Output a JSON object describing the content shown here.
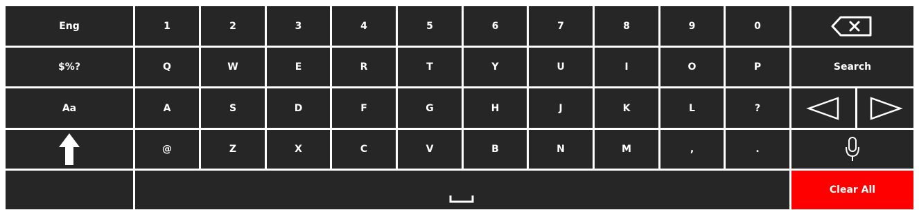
{
  "keyboard": {
    "row1": {
      "lang": "Eng",
      "digits": [
        "1",
        "2",
        "3",
        "4",
        "5",
        "6",
        "7",
        "8",
        "9",
        "0"
      ],
      "backspace_icon": "backspace-icon"
    },
    "row2": {
      "symbols": "$%?",
      "letters": [
        "Q",
        "W",
        "E",
        "R",
        "T",
        "Y",
        "U",
        "I",
        "O",
        "P"
      ],
      "search": "Search"
    },
    "row3": {
      "case": "Aa",
      "letters": [
        "A",
        "S",
        "D",
        "F",
        "G",
        "H",
        "J",
        "K",
        "L",
        "?"
      ],
      "left_icon": "arrow-left-icon",
      "right_icon": "arrow-right-icon"
    },
    "row4": {
      "shift_icon": "shift-arrow-up-icon",
      "keys": [
        "@",
        "Z",
        "X",
        "C",
        "V",
        "B",
        "N",
        "M",
        ",",
        "."
      ],
      "mic_icon": "microphone-icon"
    },
    "row5": {
      "space_icon": "space-bar-icon",
      "clear_all": "Clear All"
    },
    "colors": {
      "key_bg": "#262626",
      "key_text": "#ffffff",
      "clear_bg": "#fe0000",
      "gap": "#ffffff"
    }
  }
}
